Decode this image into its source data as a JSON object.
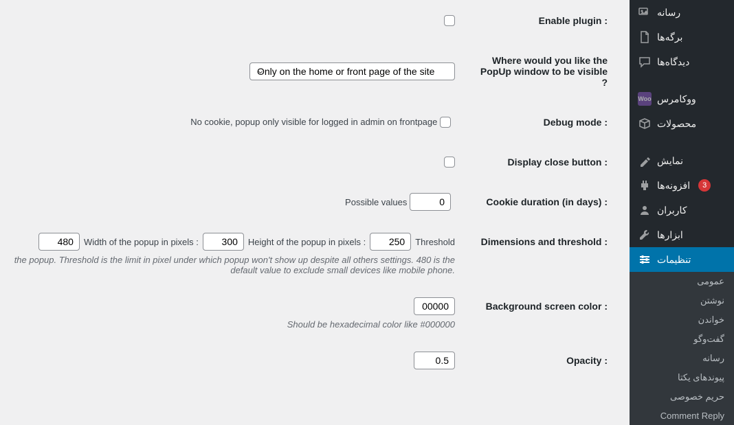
{
  "sidebar": {
    "items": [
      {
        "label": "رسانه"
      },
      {
        "label": "برگه‌ها"
      },
      {
        "label": "دیدگاه‌ها"
      },
      {
        "label": "ووکامرس"
      },
      {
        "label": "محصولات"
      },
      {
        "label": "نمایش"
      },
      {
        "label": "افزونه‌ها",
        "badge": "3"
      },
      {
        "label": "کاربران"
      },
      {
        "label": "ابزارها"
      },
      {
        "label": "تنظیمات"
      }
    ],
    "submenu": [
      {
        "label": "عمومی"
      },
      {
        "label": "نوشتن"
      },
      {
        "label": "خواندن"
      },
      {
        "label": "گفت‌وگو"
      },
      {
        "label": "رسانه"
      },
      {
        "label": "پیوندهای یکتا"
      },
      {
        "label": "حریم خصوصی"
      },
      {
        "label": "Comment Reply"
      }
    ]
  },
  "form": {
    "enable_plugin": {
      "label": "Enable plugin :"
    },
    "visible_where": {
      "label": "Where would you like the PopUp window to be visible ?",
      "selected": "Only on the home or front page of the site"
    },
    "debug_mode": {
      "label": "Debug mode :",
      "hint": "No cookie, popup only visible for logged in admin on frontpage"
    },
    "display_close": {
      "label": "Display close button :"
    },
    "cookie_duration": {
      "label": "Cookie duration (in days) :",
      "value": "0",
      "hint": "Possible values"
    },
    "dimensions": {
      "label": "Dimensions and threshold :",
      "threshold_label": "Threshold",
      "threshold_value": "250",
      "height_label": "Height of the popup in pixels :",
      "height_value": "300",
      "width_label": "Width of the popup in pixels :",
      "width_value": "480",
      "hint": "the popup. Threshold is the limit in pixel under which popup won't show up despite all others settings. 480 is the default value to exclude small devices like mobile phone."
    },
    "bg_color": {
      "label": "Background screen color :",
      "value": "00000",
      "hint": "Should be hexadecimal color like #000000"
    },
    "opacity": {
      "label": "Opacity :",
      "value": "0.5"
    }
  }
}
